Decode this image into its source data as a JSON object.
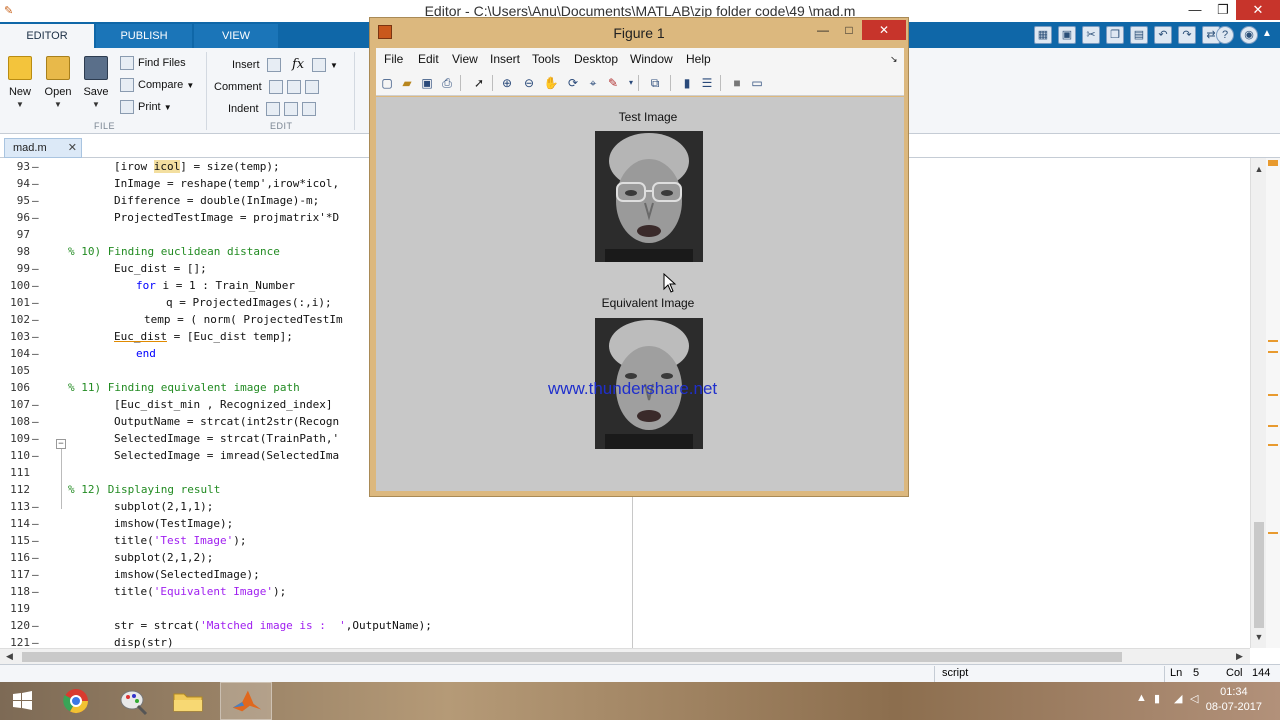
{
  "editor": {
    "title": "Editor - C:\\Users\\Anu\\Documents\\MATLAB\\zip folder code\\49 \\mad.m",
    "ribbon_tabs": [
      "EDITOR",
      "PUBLISH",
      "VIEW"
    ],
    "file_section": {
      "label": "FILE",
      "new": "New",
      "open": "Open",
      "save": "Save",
      "find_files": "Find Files",
      "compare": "Compare",
      "print": "Print"
    },
    "edit_section": {
      "label": "EDIT",
      "insert": "Insert",
      "comment": "Comment",
      "indent": "Indent",
      "fx": "fx"
    },
    "doc_tab": "mad.m",
    "lines": [
      {
        "n": "93",
        "code": "[irow icol] = size(temp);"
      },
      {
        "n": "94",
        "code": "InImage = reshape(temp',irow*icol,"
      },
      {
        "n": "95",
        "code": "Difference = double(InImage)-m;"
      },
      {
        "n": "96",
        "code": "ProjectedTestImage = projmatrix'*D"
      },
      {
        "n": "97",
        "code": ""
      },
      {
        "n": "98",
        "code": "% 10) Finding euclidean distance"
      },
      {
        "n": "99",
        "code": "Euc_dist = [];"
      },
      {
        "n": "100",
        "code": "for i = 1 : Train_Number"
      },
      {
        "n": "101",
        "code": "q = ProjectedImages(:,i);"
      },
      {
        "n": "102",
        "code": "temp = ( norm( ProjectedTestIm"
      },
      {
        "n": "103",
        "code": "Euc_dist = [Euc_dist temp];"
      },
      {
        "n": "104",
        "code": "end"
      },
      {
        "n": "105",
        "code": ""
      },
      {
        "n": "106",
        "code": "% 11) Finding equivalent image path"
      },
      {
        "n": "107",
        "code": "[Euc_dist_min , Recognized_index]"
      },
      {
        "n": "108",
        "code": "OutputName = strcat(int2str(Recogn"
      },
      {
        "n": "109",
        "code": "SelectedImage = strcat(TrainPath,'"
      },
      {
        "n": "110",
        "code": "SelectedImage = imread(SelectedIma"
      },
      {
        "n": "111",
        "code": ""
      },
      {
        "n": "112",
        "code": "% 12) Displaying result"
      },
      {
        "n": "113",
        "code": "subplot(2,1,1);"
      },
      {
        "n": "114",
        "code": "imshow(TestImage);"
      },
      {
        "n": "115",
        "code": "title('Test Image');"
      },
      {
        "n": "116",
        "code": "subplot(2,1,2);"
      },
      {
        "n": "117",
        "code": "imshow(SelectedImage);"
      },
      {
        "n": "118",
        "code": "title('Equivalent Image');"
      },
      {
        "n": "119",
        "code": ""
      },
      {
        "n": "120",
        "code": "str = strcat('Matched image is :  ',OutputName);"
      },
      {
        "n": "121",
        "code": "disp(str)"
      }
    ],
    "status": {
      "mode": "script",
      "ln_label": "Ln",
      "ln_value": "5",
      "col_label": "Col",
      "col_value": "144"
    }
  },
  "figure": {
    "title": "Figure 1",
    "menu": [
      "File",
      "Edit",
      "View",
      "Insert",
      "Tools",
      "Desktop",
      "Window",
      "Help"
    ],
    "subplot1_title": "Test Image",
    "subplot2_title": "Equivalent Image",
    "watermark": "www.thundershare.net"
  },
  "taskbar": {
    "time": "01:34",
    "date": "08-07-2017"
  },
  "colors": {
    "ribbon_blue": "#0f67a8",
    "figure_frame": "#dcb87e",
    "comment_green": "#228b22",
    "keyword_blue": "#0000ff",
    "string_purple": "#a020f0"
  }
}
